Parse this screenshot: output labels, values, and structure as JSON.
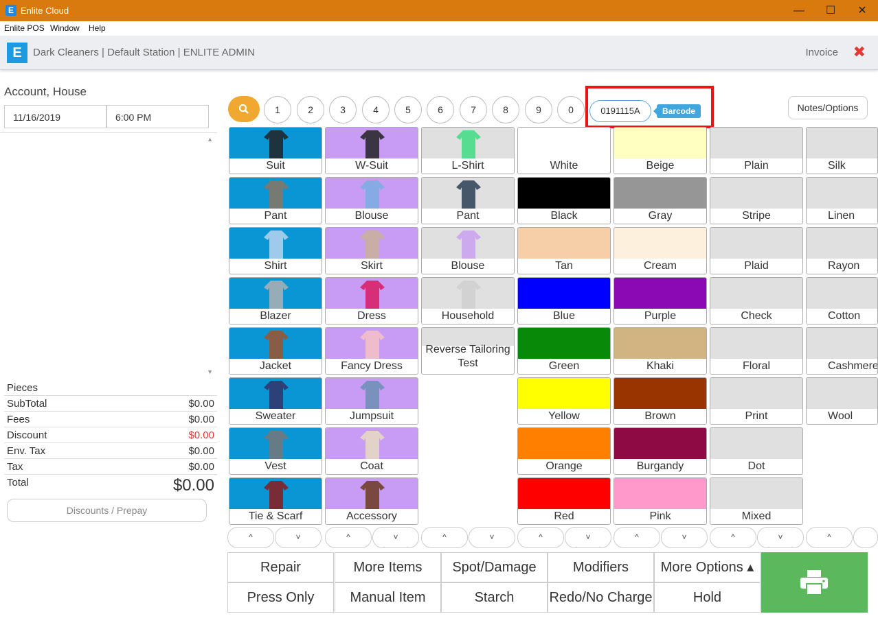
{
  "window": {
    "title": "Enlite Cloud",
    "app_icon": "E",
    "minimize": "—",
    "maximize": "☐",
    "close": "✕"
  },
  "menu": [
    "Enlite POS",
    "Window",
    "Help"
  ],
  "header": {
    "logo": "E",
    "store": "Dark Cleaners | Default Station | ENLITE ADMIN",
    "invoice_label": "Invoice",
    "close_glyph": "✖"
  },
  "left": {
    "account": "Account, House",
    "date": "11/16/2019",
    "time": "6:00 PM",
    "totals": [
      {
        "label": "Pieces",
        "value": ""
      },
      {
        "label": "SubTotal",
        "value": "$0.00"
      },
      {
        "label": "Fees",
        "value": "$0.00"
      },
      {
        "label": "Discount",
        "value": "$0.00"
      },
      {
        "label": "Env. Tax",
        "value": "$0.00"
      },
      {
        "label": "Tax",
        "value": "$0.00"
      }
    ],
    "total_label": "Total",
    "total_value": "$0.00",
    "discounts_button": "Discounts / Prepay"
  },
  "numpad": [
    "1",
    "2",
    "3",
    "4",
    "5",
    "6",
    "7",
    "8",
    "9",
    "0"
  ],
  "search_icon": "search-icon",
  "barcode": {
    "value": "0191115A",
    "tag": "Barcode"
  },
  "notes_button": "Notes/Options",
  "columns": {
    "col1": [
      "Suit",
      "Pant",
      "Shirt",
      "Blazer",
      "Jacket",
      "Sweater",
      "Vest",
      "Tie & Scarf"
    ],
    "col2": [
      "W-Suit",
      "Blouse",
      "Skirt",
      "Dress",
      "Fancy Dress",
      "Jumpsuit",
      "Coat",
      "Accessory"
    ],
    "col3": [
      "L-Shirt",
      "Pant",
      "Blouse",
      "Household",
      "Reverse Tailoring Test"
    ],
    "col4": [
      {
        "label": "White",
        "color": "#ffffff"
      },
      {
        "label": "Black",
        "color": "#000000"
      },
      {
        "label": "Tan",
        "color": "#f6cfa8"
      },
      {
        "label": "Blue",
        "color": "#0000ff"
      },
      {
        "label": "Green",
        "color": "#088a08"
      },
      {
        "label": "Yellow",
        "color": "#ffff00"
      },
      {
        "label": "Orange",
        "color": "#ff8000"
      },
      {
        "label": "Red",
        "color": "#ff0000"
      }
    ],
    "col5": [
      {
        "label": "Beige",
        "color": "#ffffc2"
      },
      {
        "label": "Gray",
        "color": "#969696"
      },
      {
        "label": "Cream",
        "color": "#fdf0dc"
      },
      {
        "label": "Purple",
        "color": "#8a09b5"
      },
      {
        "label": "Khaki",
        "color": "#d2b482"
      },
      {
        "label": "Brown",
        "color": "#993300"
      },
      {
        "label": "Burgandy",
        "color": "#8d0a45"
      },
      {
        "label": "Pink",
        "color": "#ff99cc"
      }
    ],
    "col6": [
      "Plain",
      "Stripe",
      "Plaid",
      "Check",
      "Floral",
      "Print",
      "Dot",
      "Mixed"
    ],
    "col7": [
      "Silk",
      "Linen",
      "Rayon",
      "Cotton",
      "Cashmere",
      "Wool"
    ]
  },
  "actions": {
    "row1": [
      "Repair",
      "More Items",
      "Spot/Damage",
      "Modifiers",
      "More Options ▴"
    ],
    "row2": [
      "Press Only",
      "Manual Item",
      "Starch",
      "Redo/No Charge",
      "Hold"
    ]
  },
  "print_icon": "printer-icon",
  "colors": {
    "title_bar": "#d97a0e",
    "men_tile": "#0a96d4",
    "women_tile": "#c89cf5",
    "gray_tile": "#e0e0e0",
    "print_green": "#5cb85c",
    "highlight": "#e8141c"
  }
}
